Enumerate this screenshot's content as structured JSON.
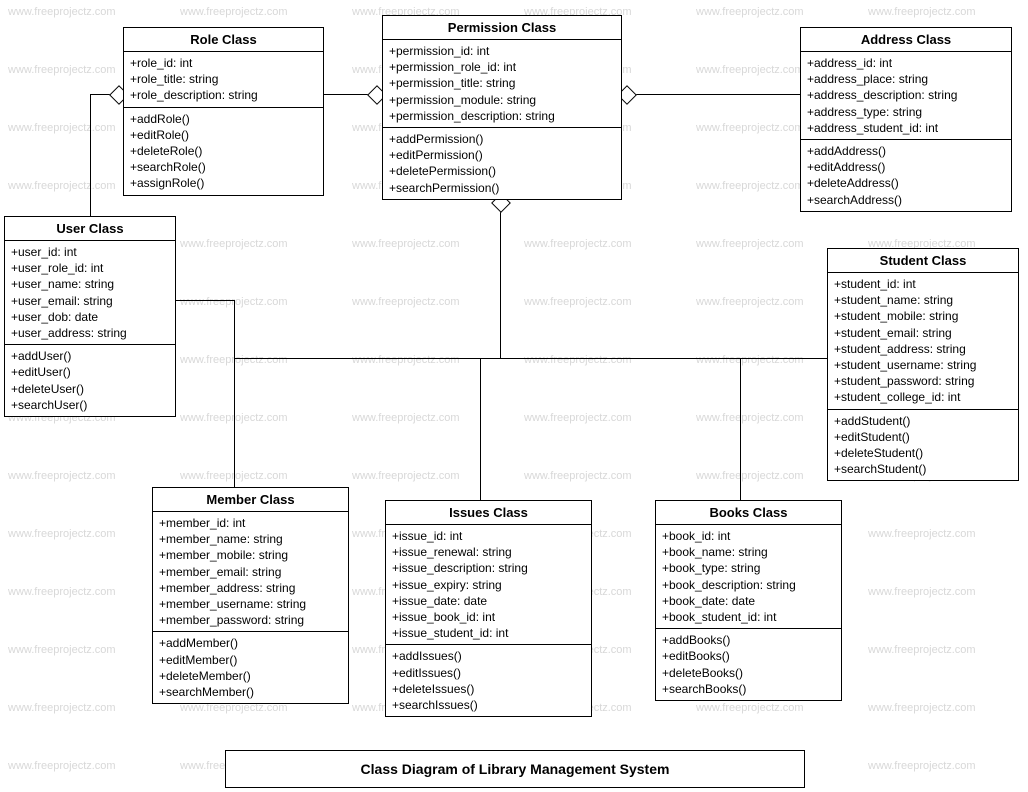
{
  "watermark_text": "www.freeprojectz.com",
  "caption": "Class Diagram of Library Management System",
  "classes": {
    "role": {
      "title": "Role Class",
      "attrs": [
        "+role_id: int",
        "+role_title: string",
        "+role_description: string"
      ],
      "ops": [
        "+addRole()",
        "+editRole()",
        "+deleteRole()",
        "+searchRole()",
        "+assignRole()"
      ]
    },
    "permission": {
      "title": "Permission Class",
      "attrs": [
        "+permission_id: int",
        "+permission_role_id: int",
        "+permission_title: string",
        "+permission_module: string",
        "+permission_description: string"
      ],
      "ops": [
        "+addPermission()",
        "+editPermission()",
        "+deletePermission()",
        "+searchPermission()"
      ]
    },
    "address": {
      "title": "Address Class",
      "attrs": [
        "+address_id: int",
        "+address_place: string",
        "+address_description: string",
        "+address_type: string",
        "+address_student_id: int"
      ],
      "ops": [
        "+addAddress()",
        "+editAddress()",
        "+deleteAddress()",
        "+searchAddress()"
      ]
    },
    "user": {
      "title": "User Class",
      "attrs": [
        "+user_id: int",
        "+user_role_id: int",
        "+user_name: string",
        "+user_email: string",
        "+user_dob: date",
        "+user_address: string"
      ],
      "ops": [
        "+addUser()",
        "+editUser()",
        "+deleteUser()",
        "+searchUser()"
      ]
    },
    "student": {
      "title": "Student Class",
      "attrs": [
        "+student_id: int",
        "+student_name: string",
        "+student_mobile: string",
        "+student_email: string",
        "+student_address: string",
        "+student_username: string",
        "+student_password: string",
        "+student_college_id: int"
      ],
      "ops": [
        "+addStudent()",
        "+editStudent()",
        "+deleteStudent()",
        "+searchStudent()"
      ]
    },
    "member": {
      "title": "Member Class",
      "attrs": [
        "+member_id: int",
        "+member_name: string",
        "+member_mobile: string",
        "+member_email: string",
        "+member_address: string",
        "+member_username: string",
        "+member_password: string"
      ],
      "ops": [
        "+addMember()",
        "+editMember()",
        "+deleteMember()",
        "+searchMember()"
      ]
    },
    "issues": {
      "title": "Issues Class",
      "attrs": [
        "+issue_id: int",
        "+issue_renewal: string",
        "+issue_description: string",
        "+issue_expiry: string",
        "+issue_date: date",
        "+issue_book_id: int",
        "+issue_student_id: int"
      ],
      "ops": [
        "+addIssues()",
        "+editIssues()",
        "+deleteIssues()",
        "+searchIssues()"
      ]
    },
    "books": {
      "title": "Books Class",
      "attrs": [
        "+book_id: int",
        "+book_name: string",
        "+book_type: string",
        "+book_description: string",
        "+book_date: date",
        "+book_student_id: int"
      ],
      "ops": [
        "+addBooks()",
        "+editBooks()",
        "+deleteBooks()",
        "+searchBooks()"
      ]
    }
  }
}
